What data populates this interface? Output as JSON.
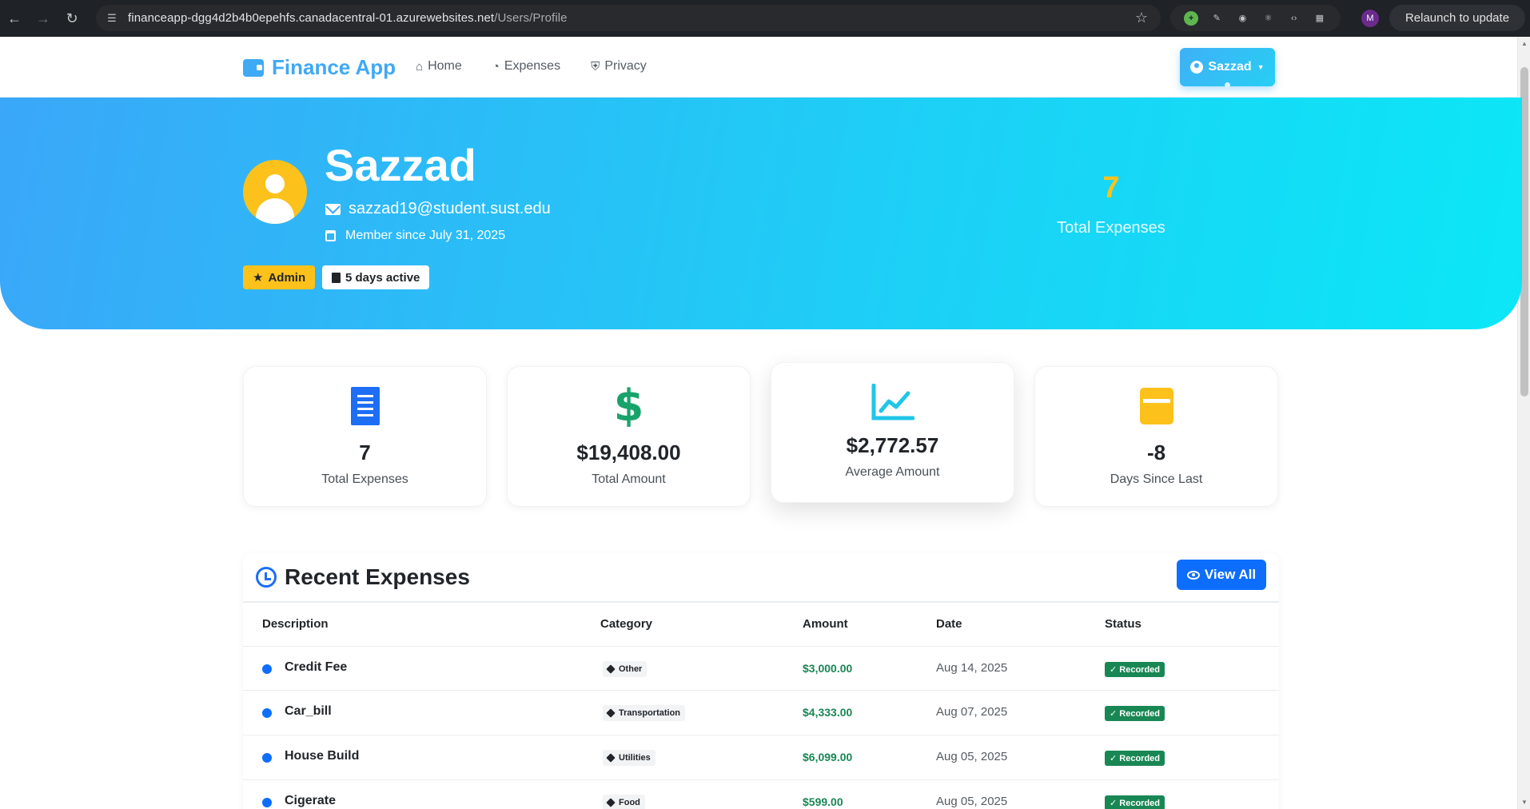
{
  "browser": {
    "url_host": "financeapp-dgg4d2b4b0epehfs.canadacentral-01.azurewebsites.net",
    "url_path": "/Users/Profile",
    "relaunch_label": "Relaunch to update",
    "profile_initial": "M"
  },
  "navbar": {
    "brand": "Finance App",
    "links": [
      {
        "label": "Home",
        "icon": "home-icon"
      },
      {
        "label": "Expenses",
        "icon": "pie-chart-icon"
      },
      {
        "label": "Privacy",
        "icon": "shield-icon"
      }
    ],
    "user_menu_label": "Sazzad"
  },
  "hero": {
    "name": "Sazzad",
    "email": "sazzad19@student.sust.edu",
    "member_since": "Member since July 31, 2025",
    "badges": {
      "admin": "Admin",
      "active": "5 days active"
    },
    "stat_value": "7",
    "stat_label": "Total Expenses",
    "gradient": [
      "#3aa7f8",
      "#0be7f6"
    ]
  },
  "stats": [
    {
      "value": "7",
      "label": "Total Expenses",
      "icon": "receipt-icon",
      "color": "#1d6ef5"
    },
    {
      "value": "$19,408.00",
      "label": "Total Amount",
      "icon": "dollar-icon",
      "color": "#18a36b"
    },
    {
      "value": "$2,772.57",
      "label": "Average Amount",
      "icon": "chart-line-icon",
      "color": "#1fc6e8"
    },
    {
      "value": "-8",
      "label": "Days Since Last",
      "icon": "calendar-icon",
      "color": "#fcc21b"
    }
  ],
  "recent": {
    "title": "Recent Expenses",
    "view_all": "View All",
    "columns": [
      "Description",
      "Category",
      "Amount",
      "Date",
      "Status"
    ],
    "rows": [
      {
        "description": "Credit Fee",
        "category": "Other",
        "amount": "$3,000.00",
        "date": "Aug 14, 2025",
        "status": "Recorded"
      },
      {
        "description": "Car_bill",
        "category": "Transportation",
        "amount": "$4,333.00",
        "date": "Aug 07, 2025",
        "status": "Recorded"
      },
      {
        "description": "House Build",
        "category": "Utilities",
        "amount": "$6,099.00",
        "date": "Aug 05, 2025",
        "status": "Recorded"
      },
      {
        "description": "Cigerate",
        "category": "Food",
        "amount": "$599.00",
        "date": "Aug 05, 2025",
        "status": "Recorded"
      }
    ]
  }
}
